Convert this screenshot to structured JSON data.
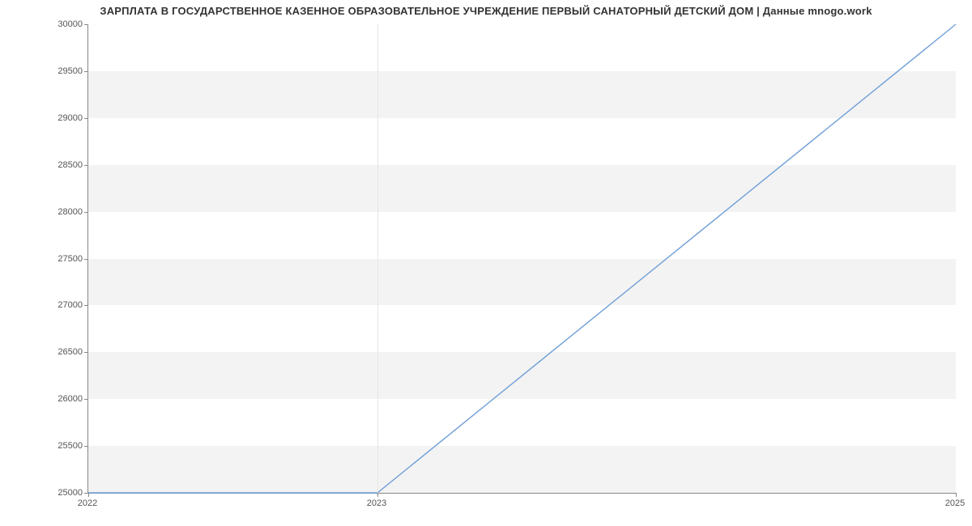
{
  "chart_data": {
    "type": "line",
    "title": "ЗАРПЛАТА В ГОСУДАРСТВЕННОЕ КАЗЕННОЕ ОБРАЗОВАТЕЛЬНОЕ УЧРЕЖДЕНИЕ ПЕРВЫЙ САНАТОРНЫЙ  ДЕТСКИЙ ДОМ | Данные mnogo.work",
    "x": [
      2022,
      2023,
      2025
    ],
    "values": [
      25000,
      25000,
      30000
    ],
    "x_ticks": [
      2022,
      2023,
      2025
    ],
    "y_ticks": [
      25000,
      25500,
      26000,
      26500,
      27000,
      27500,
      28000,
      28500,
      29000,
      29500,
      30000
    ],
    "xlim": [
      2022,
      2025
    ],
    "ylim": [
      25000,
      30000
    ],
    "xlabel": "",
    "ylabel": "",
    "series_color": "#6f9fd8"
  }
}
